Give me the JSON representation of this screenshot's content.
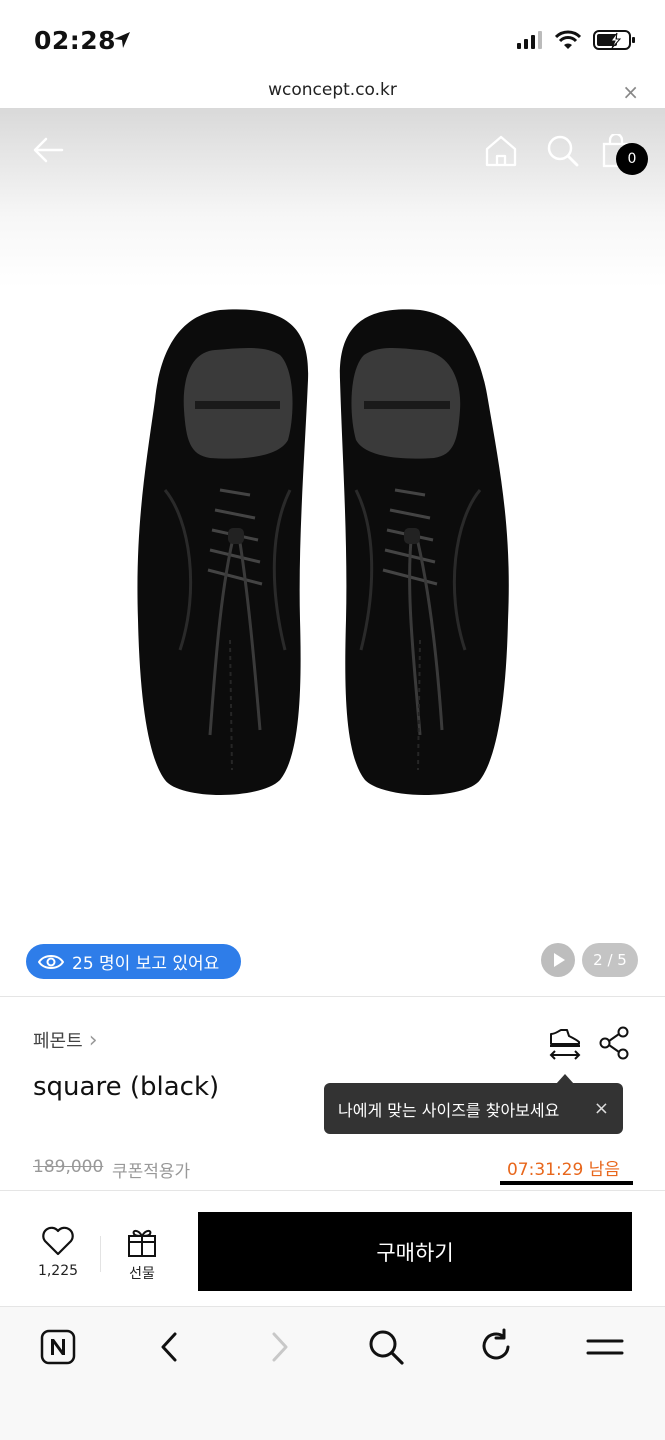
{
  "status_bar": {
    "time": "02:28"
  },
  "browser": {
    "url": "wconcept.co.kr",
    "close_symbol": "×"
  },
  "header": {
    "cart_count": "0"
  },
  "gallery": {
    "viewers_text": "25 명이 보고 있어요",
    "page_indicator": "2 / 5",
    "accent_color": "#2e7de9"
  },
  "product": {
    "brand": "페몬트",
    "brand_chevron": "›",
    "name": "square (black)",
    "original_price": "189,000",
    "coupon_label": "쿠폰적용가",
    "timer": "07:31:29 남음"
  },
  "tooltip": {
    "text": "나에게 맞는 사이즈를 찾아보세요",
    "close_symbol": "×"
  },
  "purchase_bar": {
    "like_count": "1,225",
    "gift_label": "선물",
    "buy_label": "구매하기"
  },
  "icons": {
    "back": "arrow-left-icon",
    "home": "home-icon",
    "search": "search-icon",
    "cart": "shopping-bag-icon",
    "eye": "eye-icon",
    "play": "play-icon",
    "size": "size-guide-icon",
    "share": "share-icon",
    "like": "heart-icon",
    "gift": "gift-icon",
    "naver": "naver-n-icon",
    "refresh": "refresh-icon",
    "menu": "menu-icon"
  }
}
